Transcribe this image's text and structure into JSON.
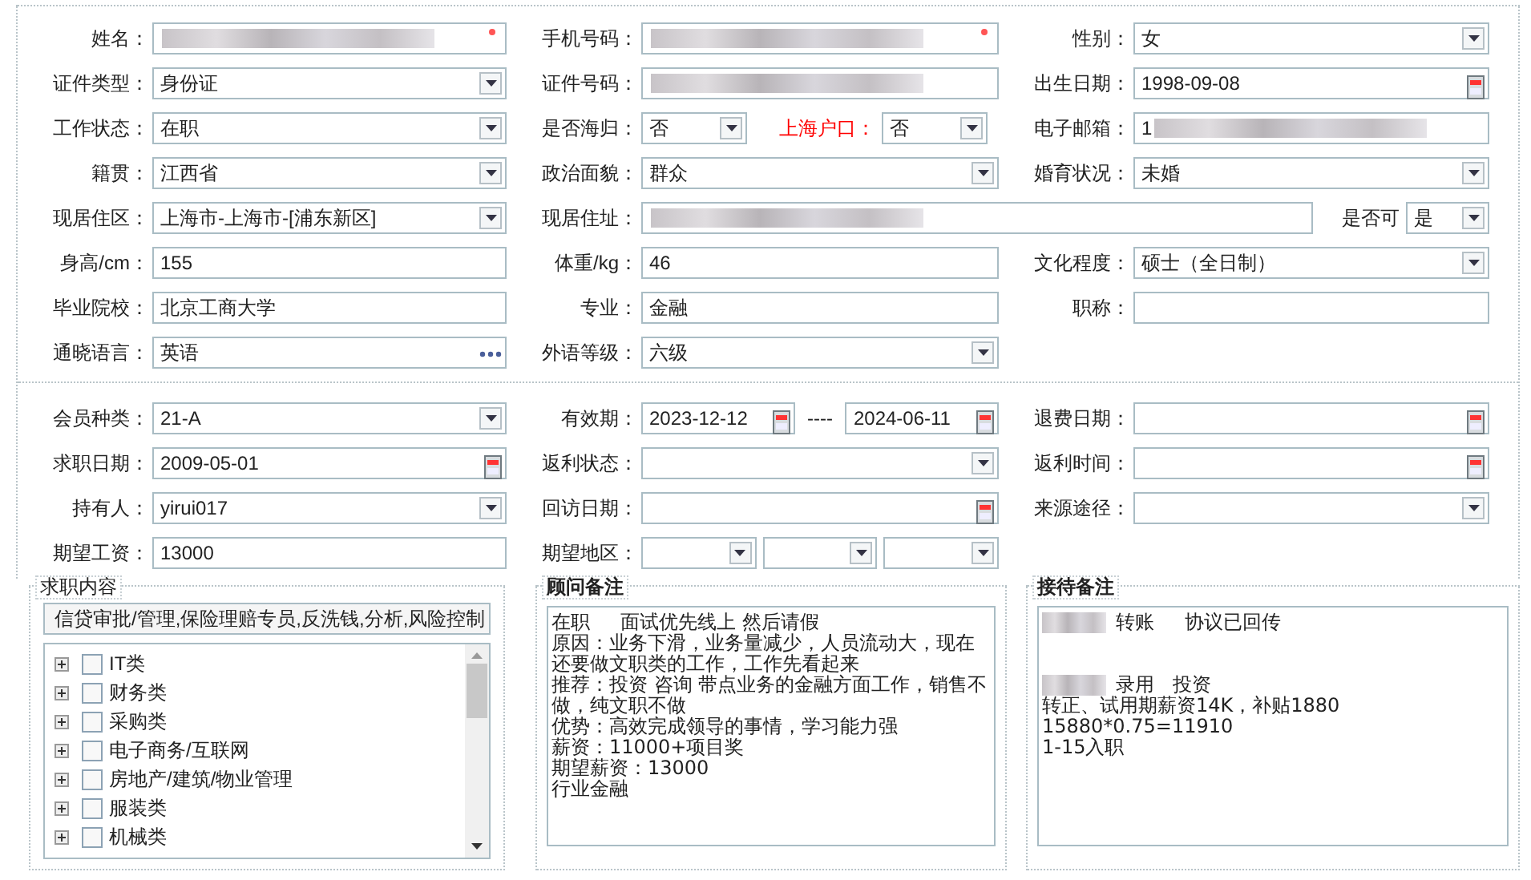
{
  "sections": [
    {
      "rows": [
        {
          "kind": "standard",
          "slots": [
            {
              "label": "姓名：",
              "controls": [
                {
                  "kind": "text",
                  "redacted": true,
                  "required": true
                }
              ]
            },
            {
              "label": "手机号码：",
              "controls": [
                {
                  "kind": "text",
                  "redacted": true,
                  "required": true
                }
              ]
            },
            {
              "label": "性别：",
              "controls": [
                {
                  "kind": "select",
                  "value": "女"
                }
              ]
            }
          ]
        },
        {
          "kind": "standard",
          "slots": [
            {
              "label": "证件类型：",
              "controls": [
                {
                  "kind": "select",
                  "value": "身份证"
                }
              ]
            },
            {
              "label": "证件号码：",
              "controls": [
                {
                  "kind": "text",
                  "redacted": true
                }
              ]
            },
            {
              "label": "出生日期：",
              "controls": [
                {
                  "kind": "date",
                  "value": "1998-09-08"
                }
              ]
            }
          ]
        },
        {
          "kind": "standard",
          "slots": [
            {
              "label": "工作状态：",
              "controls": [
                {
                  "kind": "select",
                  "value": "在职"
                }
              ]
            },
            {
              "label": "是否海归：",
              "controls": [
                {
                  "kind": "select",
                  "value": "否"
                },
                {
                  "kind": "label",
                  "text": "上海户口：",
                  "emphasis": true
                },
                {
                  "kind": "select",
                  "value": "否"
                }
              ]
            },
            {
              "label": "电子邮箱：",
              "controls": [
                {
                  "kind": "text",
                  "value": "1",
                  "redacted": true
                }
              ]
            }
          ]
        },
        {
          "kind": "standard",
          "slots": [
            {
              "label": "籍贯：",
              "controls": [
                {
                  "kind": "select",
                  "value": "江西省"
                }
              ]
            },
            {
              "label": "政治面貌：",
              "controls": [
                {
                  "kind": "select",
                  "value": "群众"
                }
              ]
            },
            {
              "label": "婚育状况：",
              "controls": [
                {
                  "kind": "select",
                  "value": "未婚"
                }
              ]
            }
          ]
        },
        {
          "kind": "merged",
          "slots": [
            {
              "label": "现居住区：",
              "controls": [
                {
                  "kind": "select",
                  "value": "上海市-上海市-[浦东新区]"
                }
              ]
            },
            {
              "label": "现居住址：",
              "controls": [
                {
                  "kind": "text",
                  "redacted": true
                }
              ]
            },
            {
              "label": "是否可",
              "controls": [
                {
                  "kind": "select",
                  "value": "是"
                }
              ]
            }
          ]
        },
        {
          "kind": "standard",
          "slots": [
            {
              "label": "身高/cm：",
              "controls": [
                {
                  "kind": "text",
                  "value": "155"
                }
              ]
            },
            {
              "label": "体重/kg：",
              "controls": [
                {
                  "kind": "text",
                  "value": "46"
                }
              ]
            },
            {
              "label": "文化程度：",
              "controls": [
                {
                  "kind": "select",
                  "value": "硕士（全日制）"
                }
              ]
            }
          ]
        },
        {
          "kind": "standard",
          "slots": [
            {
              "label": "毕业院校：",
              "controls": [
                {
                  "kind": "text",
                  "value": "北京工商大学"
                }
              ]
            },
            {
              "label": "专业：",
              "controls": [
                {
                  "kind": "text",
                  "value": "金融"
                }
              ]
            },
            {
              "label": "职称：",
              "controls": [
                {
                  "kind": "text"
                }
              ]
            }
          ]
        },
        {
          "kind": "standard",
          "slots": [
            {
              "label": "通晓语言：",
              "controls": [
                {
                  "kind": "picker",
                  "value": "英语"
                }
              ]
            },
            {
              "label": "外语等级：",
              "controls": [
                {
                  "kind": "select",
                  "value": "六级"
                }
              ]
            }
          ]
        }
      ]
    },
    {
      "rows": [
        {
          "kind": "standard",
          "slots": [
            {
              "label": "会员种类：",
              "controls": [
                {
                  "kind": "select",
                  "value": "21-A"
                }
              ]
            },
            {
              "label": "有效期：",
              "controls": [
                {
                  "kind": "date",
                  "value": "2023-12-12"
                },
                {
                  "kind": "separator",
                  "text": "----"
                },
                {
                  "kind": "date",
                  "value": "2024-06-11"
                }
              ]
            },
            {
              "label": "退费日期：",
              "controls": [
                {
                  "kind": "date"
                }
              ]
            }
          ]
        },
        {
          "kind": "standard",
          "slots": [
            {
              "label": "求职日期：",
              "controls": [
                {
                  "kind": "date",
                  "value": "2009-05-01"
                }
              ]
            },
            {
              "label": "返利状态：",
              "controls": [
                {
                  "kind": "select"
                }
              ]
            },
            {
              "label": "返利时间：",
              "controls": [
                {
                  "kind": "date"
                }
              ]
            }
          ]
        },
        {
          "kind": "standard",
          "slots": [
            {
              "label": "持有人：",
              "controls": [
                {
                  "kind": "select",
                  "value": "yirui017"
                }
              ]
            },
            {
              "label": "回访日期：",
              "controls": [
                {
                  "kind": "date"
                }
              ]
            },
            {
              "label": "来源途径：",
              "controls": [
                {
                  "kind": "select"
                }
              ]
            }
          ]
        },
        {
          "kind": "standard",
          "slots": [
            {
              "label": "期望工资：",
              "controls": [
                {
                  "kind": "text",
                  "value": "13000"
                }
              ]
            },
            {
              "label": "期望地区：",
              "controls": [
                {
                  "kind": "select"
                },
                {
                  "kind": "select"
                },
                {
                  "kind": "select"
                }
              ]
            }
          ]
        }
      ]
    }
  ],
  "job_panel": {
    "legend": "求职内容",
    "summary": "信贷审批/管理,保险理赔专员,反洗钱,分析,风险控制",
    "tree": [
      {
        "label": "IT类",
        "checked": false,
        "expanded": false
      },
      {
        "label": "财务类",
        "checked": false,
        "expanded": false
      },
      {
        "label": "采购类",
        "checked": false,
        "expanded": false
      },
      {
        "label": "电子商务/互联网",
        "checked": false,
        "expanded": false
      },
      {
        "label": "房地产/建筑/物业管理",
        "checked": false,
        "expanded": false
      },
      {
        "label": "服装类",
        "checked": false,
        "expanded": false
      },
      {
        "label": "机械类",
        "checked": false,
        "expanded": false
      }
    ]
  },
  "consultant_notes": {
    "legend": "顾问备注",
    "paragraphs": [
      [
        {
          "text": "在职     面试优先线上 然后请假"
        },
        {
          "text": "原因：业务下滑，业务量减少，人员流动大，现在还要做文职类的工作，工作先看起来"
        },
        {
          "text": "推荐：投资 咨询 带点业务的金融方面工作，销售不做，纯文职不做"
        },
        {
          "text": "优势：高效完成领导的事情，学习能力强"
        },
        {
          "text": "薪资：11000+项目奖"
        },
        {
          "text": "期望薪资：13000"
        },
        {
          "text": "行业金融"
        }
      ]
    ]
  },
  "reception_notes": {
    "legend": "接待备注",
    "paragraphs": [
      [
        {
          "text": "转账     协议已回传",
          "redacted": true
        }
      ],
      [
        {
          "text": "录用   投资",
          "redacted": true
        },
        {
          "text": "转正、试用期薪资14K，补贴1880"
        },
        {
          "text": "15880*0.75=11910"
        },
        {
          "text": "1-15入职"
        }
      ]
    ]
  }
}
